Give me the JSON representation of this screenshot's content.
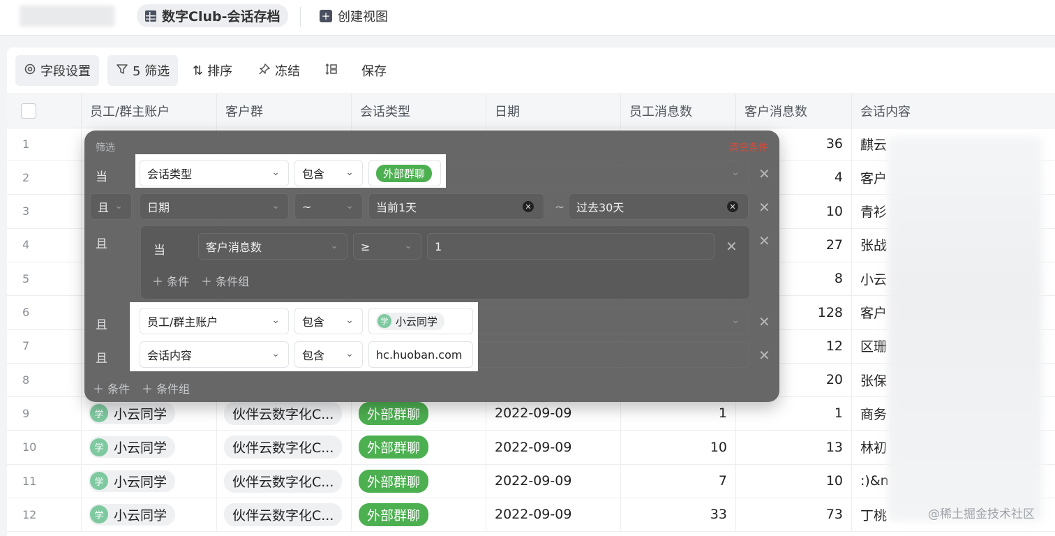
{
  "topbar": {
    "view_tab_label": "数字Club-会话存档",
    "create_view_label": "创建视图"
  },
  "toolbar": {
    "field_settings": "字段设置",
    "filter": "5 筛选",
    "sort": "排序",
    "freeze": "冻结",
    "save": "保存"
  },
  "columns": [
    "员工/群主账户",
    "客户群",
    "会话类型",
    "日期",
    "员工消息数",
    "客户消息数",
    "会话内容"
  ],
  "rows": [
    {
      "num": "1",
      "cust_msgs": "36",
      "content": "麒云"
    },
    {
      "num": "2",
      "cust_msgs": "4",
      "content": "客户"
    },
    {
      "num": "3",
      "cust_msgs": "10",
      "content": "青衫"
    },
    {
      "num": "4",
      "cust_msgs": "27",
      "content": "张战"
    },
    {
      "num": "5",
      "cust_msgs": "8",
      "content": "小云"
    },
    {
      "num": "6",
      "cust_msgs": "128",
      "content": "客户"
    },
    {
      "num": "7",
      "cust_msgs": "12",
      "content": "区珊"
    },
    {
      "num": "8",
      "cust_msgs": "20",
      "content": "张保"
    },
    {
      "num": "9",
      "user": "小云同学",
      "avatar": "学",
      "group": "伙伴云数字化C...",
      "type": "外部群聊",
      "date": "2022-09-09",
      "emp_msgs": "1",
      "cust_msgs": "1",
      "content": "商务"
    },
    {
      "num": "10",
      "user": "小云同学",
      "avatar": "学",
      "group": "伙伴云数字化C...",
      "type": "外部群聊",
      "date": "2022-09-09",
      "emp_msgs": "10",
      "cust_msgs": "13",
      "content": "林初"
    },
    {
      "num": "11",
      "user": "小云同学",
      "avatar": "学",
      "group": "伙伴云数字化C...",
      "type": "外部群聊",
      "date": "2022-09-09",
      "emp_msgs": "7",
      "cust_msgs": "10",
      "content": ":)&n"
    },
    {
      "num": "12",
      "user": "小云同学",
      "avatar": "学",
      "group": "伙伴云数字化C...",
      "type": "外部群聊",
      "date": "2022-09-09",
      "emp_msgs": "33",
      "cust_msgs": "73",
      "content": "丁桃"
    }
  ],
  "filter": {
    "title": "筛选",
    "clear": "清空条件",
    "when": "当",
    "and": "且",
    "c1": {
      "field": "会话类型",
      "op": "包含",
      "value": "外部群聊"
    },
    "c2": {
      "field": "日期",
      "op": "~",
      "from": "当前1天",
      "sep": "~",
      "to": "过去30天"
    },
    "c3": {
      "field": "客户消息数",
      "op": "≥",
      "value": "1"
    },
    "nested_add_condition": "条件",
    "nested_add_group": "条件组",
    "c4": {
      "field": "员工/群主账户",
      "op": "包含",
      "value": "小云同学",
      "avatar": "学"
    },
    "c5": {
      "field": "会话内容",
      "op": "包含",
      "value": "hc.huoban.com"
    },
    "add_condition": "条件",
    "add_group": "条件组"
  },
  "watermark": "@稀土掘金技术社区"
}
